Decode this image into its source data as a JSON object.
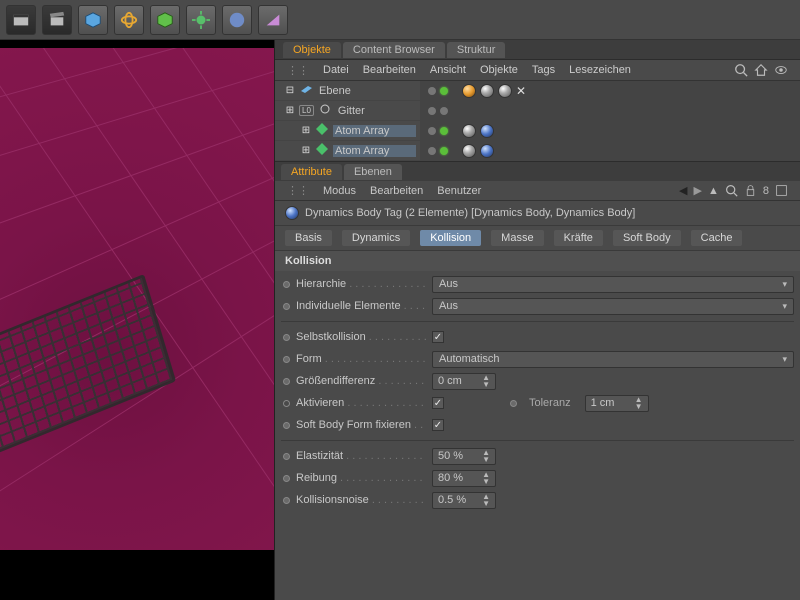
{
  "toolbar_icons": [
    "film",
    "clapper",
    "cube",
    "rings",
    "cube-green",
    "gear",
    "sphere",
    "wedge"
  ],
  "objects_panel": {
    "tabs": [
      "Objekte",
      "Content Browser",
      "Struktur"
    ],
    "active_tab": 0,
    "menu": [
      "Datei",
      "Bearbeiten",
      "Ansicht",
      "Objekte",
      "Tags",
      "Lesezeichen"
    ]
  },
  "object_tree": [
    {
      "indent": 0,
      "expand": "collapse",
      "icon": "plane",
      "label": "Ebene",
      "dots": [
        "gray",
        "green"
      ],
      "tags": [
        "orange",
        "gray",
        "white",
        "x"
      ]
    },
    {
      "indent": 0,
      "expand": "expand",
      "icon": "null",
      "nullbadge": true,
      "label": "Gitter",
      "dots": [
        "gray",
        "gray"
      ],
      "tags": []
    },
    {
      "indent": 1,
      "expand": "expand",
      "icon": "array",
      "label": "Atom Array",
      "dots": [
        "gray",
        "green"
      ],
      "tags": [
        "gray",
        "blue"
      ],
      "selected": true
    },
    {
      "indent": 1,
      "expand": "expand",
      "icon": "array",
      "label": "Atom Array",
      "dots": [
        "gray",
        "green"
      ],
      "tags": [
        "gray",
        "blue"
      ],
      "selected": true
    }
  ],
  "attributes_panel": {
    "tabs": [
      "Attribute",
      "Ebenen"
    ],
    "active_tab": 0,
    "menu": [
      "Modus",
      "Bearbeiten",
      "Benutzer"
    ],
    "header": "Dynamics Body Tag (2 Elemente) [Dynamics Body, Dynamics Body]",
    "sub_tabs": [
      "Basis",
      "Dynamics",
      "Kollision",
      "Masse",
      "Kräfte",
      "Soft Body",
      "Cache"
    ],
    "active_sub": 2,
    "section": "Kollision",
    "rows": [
      {
        "label": "Hierarchie",
        "type": "dropdown",
        "value": "Aus"
      },
      {
        "label": "Individuelle Elemente",
        "type": "dropdown",
        "value": "Aus"
      },
      {
        "sep": true
      },
      {
        "label": "Selbstkollision",
        "type": "check",
        "value": true
      },
      {
        "label": "Form",
        "type": "dropdown",
        "value": "Automatisch"
      },
      {
        "label": "Größendifferenz",
        "type": "num",
        "value": "0 cm"
      },
      {
        "label": "Aktivieren",
        "type": "check",
        "value": true,
        "no_bullet": true,
        "extra_label": "Toleranz",
        "extra_value": "1 cm"
      },
      {
        "label": "Soft Body Form fixieren",
        "type": "check",
        "value": true
      },
      {
        "sep": true
      },
      {
        "label": "Elastizität",
        "type": "num",
        "value": "50 %"
      },
      {
        "label": "Reibung",
        "type": "num",
        "value": "80 %"
      },
      {
        "label": "Kollisionsnoise",
        "type": "num",
        "value": "0.5 %"
      }
    ]
  }
}
